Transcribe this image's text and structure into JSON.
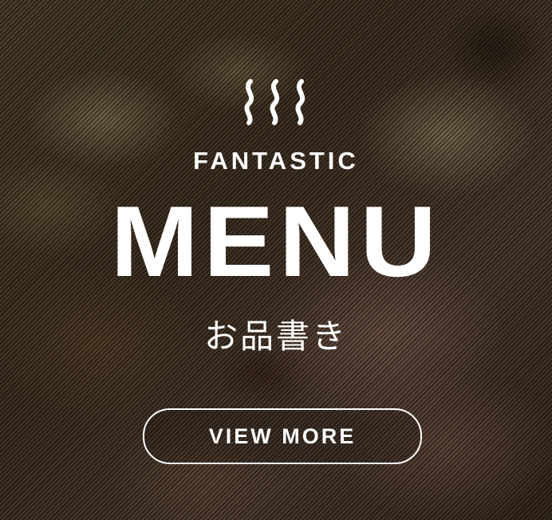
{
  "banner": {
    "icon": "steam-icon",
    "subtitle": "FANTASTIC",
    "title": "MENU",
    "japanese_title": "お品書き",
    "button_label": "VIEW MORE"
  },
  "colors": {
    "text": "#ffffff",
    "overlay": "#000000"
  }
}
